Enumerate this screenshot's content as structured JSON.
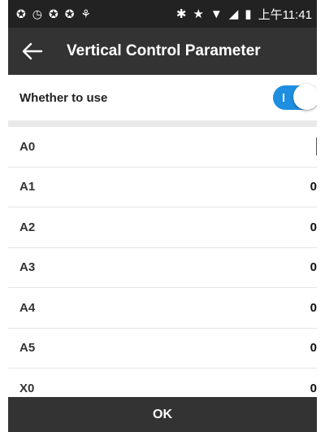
{
  "status": {
    "left_icons": [
      "app-icon",
      "clock-icon",
      "app-icon",
      "app-icon",
      "usb-icon"
    ],
    "time": "上午11:41"
  },
  "header": {
    "title": "Vertical Control Parameter"
  },
  "toggle": {
    "label": "Whether to use",
    "state": "on"
  },
  "rows": [
    {
      "label": "A0",
      "value": ""
    },
    {
      "label": "A1",
      "value": "0"
    },
    {
      "label": "A2",
      "value": "0"
    },
    {
      "label": "A3",
      "value": "0"
    },
    {
      "label": "A4",
      "value": "0"
    },
    {
      "label": "A5",
      "value": "0"
    },
    {
      "label": "X0",
      "value": "0"
    }
  ],
  "footer": {
    "ok_label": "OK"
  },
  "colors": {
    "accent": "#1e8fe0",
    "bar": "#333333"
  }
}
